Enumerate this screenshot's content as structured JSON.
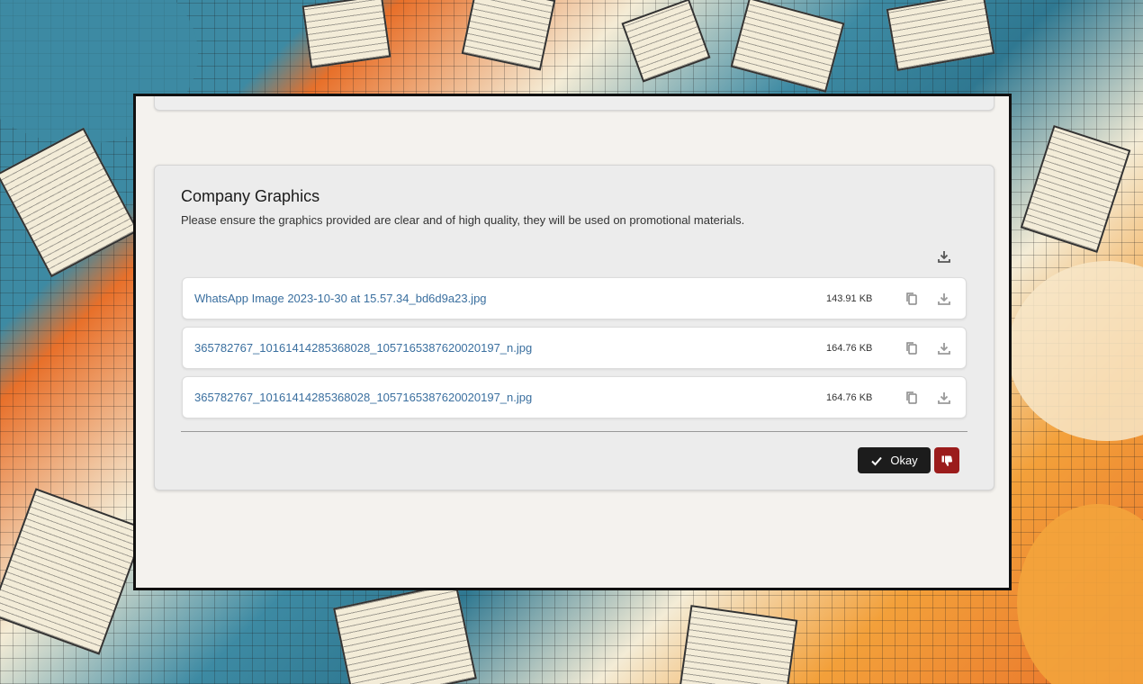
{
  "section": {
    "title": "Company Graphics",
    "description": "Please ensure the graphics provided are clear and of high quality, they will be used on promotional materials."
  },
  "files": [
    {
      "name": "WhatsApp Image 2023-10-30 at 15.57.34_bd6d9a23.jpg",
      "size": "143.91 KB"
    },
    {
      "name": "365782767_10161414285368028_1057165387620020197_n.jpg",
      "size": "164.76 KB"
    },
    {
      "name": "365782767_10161414285368028_1057165387620020197_n.jpg",
      "size": "164.76 KB"
    }
  ],
  "actions": {
    "okay_label": "Okay"
  },
  "icons": {
    "download_all": "download-icon",
    "copy": "copy-icon",
    "download": "download-icon",
    "check": "check-icon",
    "reject": "thumbs-down-icon"
  },
  "colors": {
    "link": "#3a6f9f",
    "okay_button": "#1c1c1c",
    "reject_button": "#9b1c1c"
  }
}
